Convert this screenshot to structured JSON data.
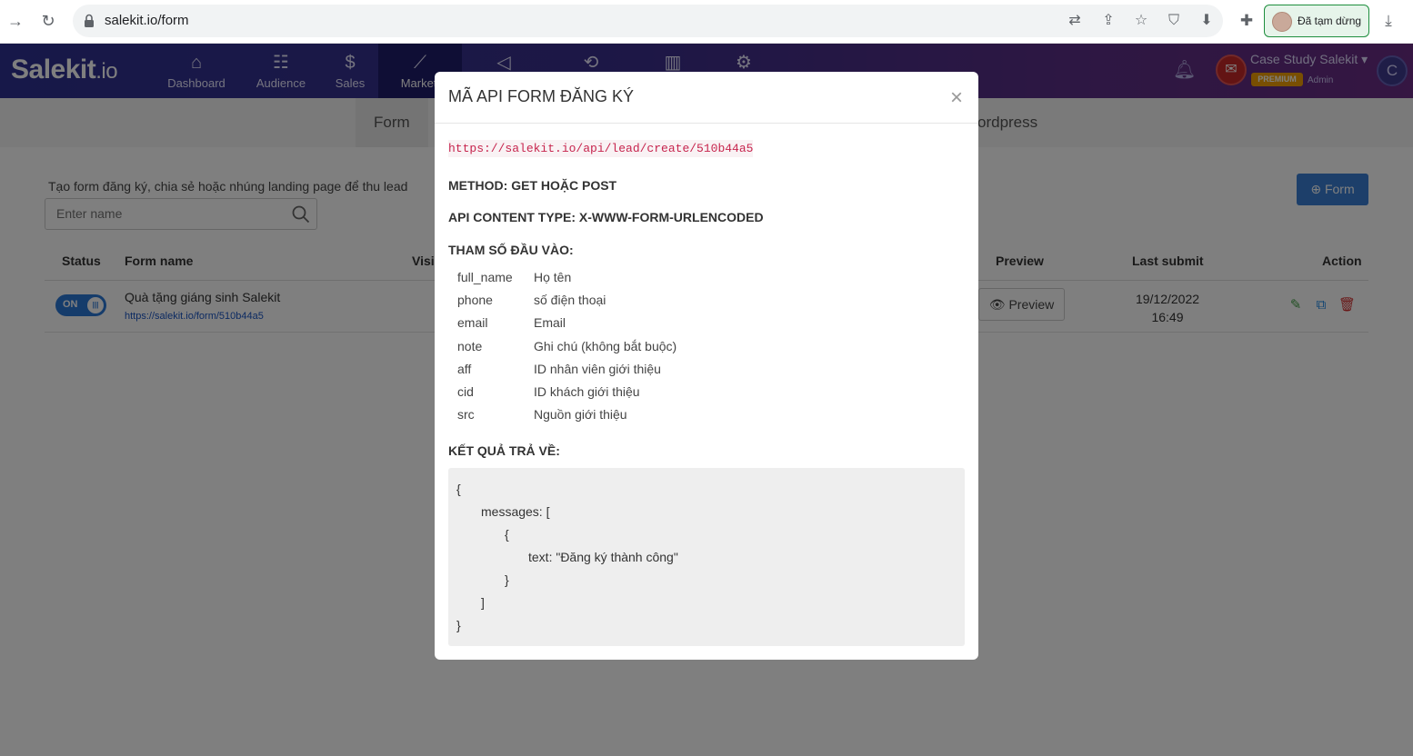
{
  "browser": {
    "url": "salekit.io/form",
    "profile_status": "Đã tạm dừng"
  },
  "header": {
    "logo_main": "Salekit",
    "logo_suffix": ".io",
    "nav": [
      {
        "label": "Dashboard",
        "icon": "home-icon"
      },
      {
        "label": "Audience",
        "icon": "users-icon"
      },
      {
        "label": "Sales",
        "icon": "dollar-icon"
      },
      {
        "label": "Marketi",
        "icon": "chart-icon"
      }
    ],
    "user_name": "Case Study Salekit",
    "badge": "PREMIUM",
    "role": "Admin",
    "avatar_letter": "C"
  },
  "subnav": {
    "tabs": [
      "Form",
      "ordpress"
    ]
  },
  "page": {
    "description": "Tạo form đăng ký, chia sẻ hoặc nhúng landing page để thu lead",
    "search_placeholder": "Enter name",
    "form_button": "Form",
    "columns": {
      "status": "Status",
      "form_name": "Form name",
      "visits": "Visi",
      "preview": "Preview",
      "last_submit": "Last submit",
      "action": "Action"
    },
    "rows": [
      {
        "status": "ON",
        "name": "Quà tặng giáng sinh Salekit",
        "url": "https://salekit.io/form/510b44a5",
        "visits": "",
        "preview_label": "Preview",
        "last_submit_date": "19/12/2022",
        "last_submit_time": "16:49"
      }
    ]
  },
  "modal": {
    "title": "MÃ API FORM ĐĂNG KÝ",
    "close": "×",
    "api_url": "https://salekit.io/api/lead/create/510b44a5",
    "method": "METHOD: GET HOẶC POST",
    "content_type": "API CONTENT TYPE: X-WWW-FORM-URLENCODED",
    "params_heading": "THAM SỐ ĐẦU VÀO:",
    "params": [
      {
        "key": "full_name",
        "desc": "Họ tên"
      },
      {
        "key": "phone",
        "desc": "số điện thoại"
      },
      {
        "key": "email",
        "desc": "Email"
      },
      {
        "key": "note",
        "desc": "Ghi chú (không bắt buộc)"
      },
      {
        "key": "aff",
        "desc": "ID nhân viên giới thiệu"
      },
      {
        "key": "cid",
        "desc": "ID khách giới thiệu"
      },
      {
        "key": "src",
        "desc": "Nguồn giới thiệu"
      }
    ],
    "result_heading": "KẾT QUẢ TRẢ VỀ:",
    "code_lines": [
      "{",
      "messages: [",
      "{",
      "text: \"Đăng ký thành công\"",
      "}",
      "]",
      "}"
    ]
  },
  "colors": {
    "brand_primary": "#2e3192",
    "button_blue": "#3a7fd5",
    "url_code": "#c7254e",
    "delete_red": "#d32f2f",
    "edit_green": "#43a047"
  }
}
